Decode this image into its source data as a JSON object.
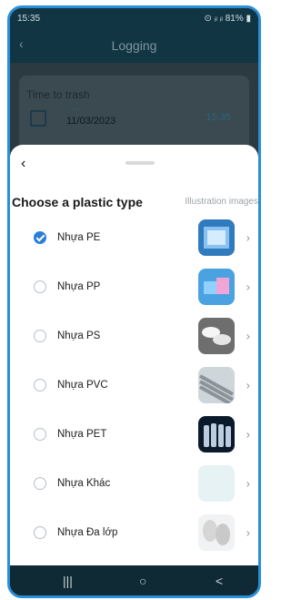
{
  "status_bar": {
    "time": "15:35",
    "battery": "81%",
    "icons": "signal-icons"
  },
  "header": {
    "title": "Logging",
    "back_icon": "chevron-left-icon"
  },
  "background_card": {
    "title": "Time to trash",
    "date_label": "Date",
    "date_value": "11/03/2023",
    "time_value": "15:35"
  },
  "sheet": {
    "title": "Choose a plastic type",
    "subtitle": "Illustration images",
    "back_icon": "chevron-left-icon",
    "options": [
      {
        "label": "Nhựa PE",
        "checked": true,
        "image": "plastic-bags"
      },
      {
        "label": "Nhựa PP",
        "checked": false,
        "image": "plastic-containers"
      },
      {
        "label": "Nhựa PS",
        "checked": false,
        "image": "foam-cups"
      },
      {
        "label": "Nhựa PVC",
        "checked": false,
        "image": "pvc-pipes"
      },
      {
        "label": "Nhựa PET",
        "checked": false,
        "image": "water-bottles"
      },
      {
        "label": "Nhựa Khác",
        "checked": false,
        "image": "blank"
      },
      {
        "label": "Nhựa Đa lớp",
        "checked": false,
        "image": "multilayer-rolls"
      }
    ]
  },
  "nav_bar": {
    "recent": "|||",
    "home": "○",
    "back": "<"
  }
}
